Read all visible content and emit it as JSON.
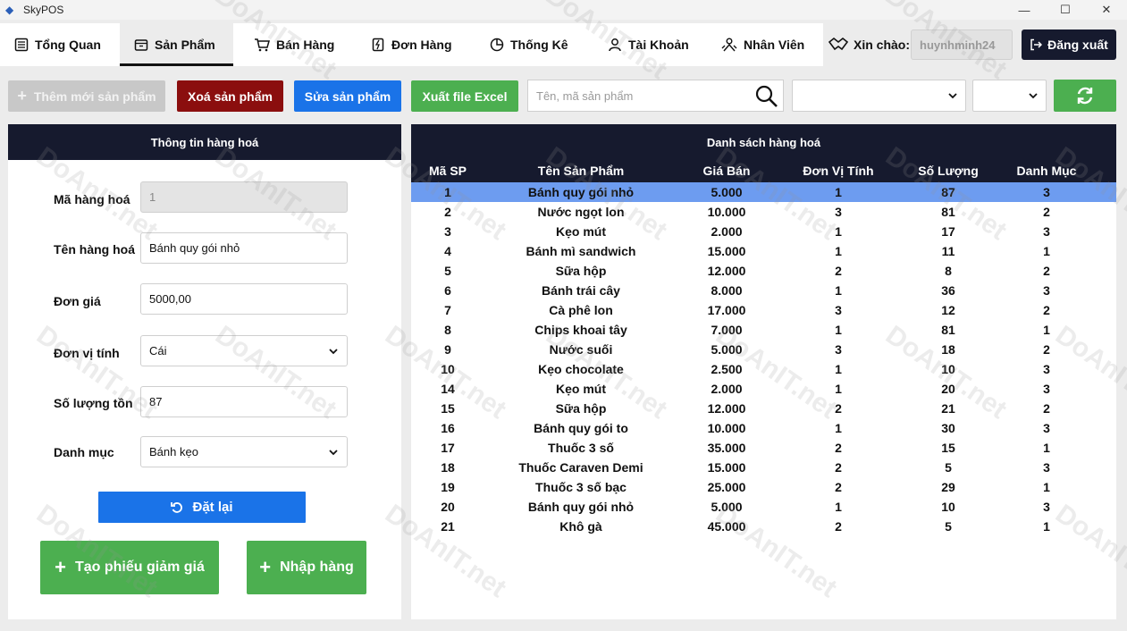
{
  "window": {
    "title": "SkyPOS",
    "minimize": "—",
    "maximize": "☐",
    "close": "✕"
  },
  "nav": {
    "tabs": [
      {
        "label": "Tổng Quan"
      },
      {
        "label": "Sản Phẩm"
      },
      {
        "label": "Bán Hàng"
      },
      {
        "label": "Đơn Hàng"
      },
      {
        "label": "Thống Kê"
      },
      {
        "label": "Tài Khoản"
      },
      {
        "label": "Nhân Viên"
      }
    ],
    "greeting": "Xin chào:",
    "username": "huynhminh24",
    "logout": "Đăng xuất"
  },
  "toolbar": {
    "add": "Thêm mới sản phẩm",
    "delete": "Xoá sản phẩm",
    "edit": "Sửa sản phẩm",
    "export": "Xuất file Excel",
    "search_placeholder": "Tên, mã sản phẩm",
    "filter1": "",
    "filter2": ""
  },
  "form": {
    "title": "Thông tin hàng hoá",
    "code_label": "Mã hàng hoá",
    "code_value": "1",
    "name_label": "Tên hàng hoá",
    "name_value": "Bánh quy gói nhỏ",
    "price_label": "Đơn giá",
    "price_value": "5000,00",
    "unit_label": "Đơn vị tính",
    "unit_value": "Cái",
    "stock_label": "Số lượng tồn",
    "stock_value": "87",
    "category_label": "Danh mục",
    "category_value": "Bánh kẹo",
    "reset": "Đặt lại",
    "discount": "Tạo phiếu giảm giá",
    "import": "Nhập hàng"
  },
  "list": {
    "title": "Danh sách hàng hoá",
    "columns": [
      "Mã SP",
      "Tên Sản Phẩm",
      "Giá Bán",
      "Đơn Vị Tính",
      "Số Lượng",
      "Danh Mục"
    ],
    "rows": [
      [
        "1",
        "Bánh quy gói nhỏ",
        "5.000",
        "1",
        "87",
        "3"
      ],
      [
        "2",
        "Nước ngọt lon",
        "10.000",
        "3",
        "81",
        "2"
      ],
      [
        "3",
        "Kẹo mút",
        "2.000",
        "1",
        "17",
        "3"
      ],
      [
        "4",
        "Bánh mì sandwich",
        "15.000",
        "1",
        "11",
        "1"
      ],
      [
        "5",
        "Sữa hộp",
        "12.000",
        "2",
        "8",
        "2"
      ],
      [
        "6",
        "Bánh trái cây",
        "8.000",
        "1",
        "36",
        "3"
      ],
      [
        "7",
        "Cà phê lon",
        "17.000",
        "3",
        "12",
        "2"
      ],
      [
        "8",
        "Chips khoai tây",
        "7.000",
        "1",
        "81",
        "1"
      ],
      [
        "9",
        "Nước suối",
        "5.000",
        "3",
        "18",
        "2"
      ],
      [
        "10",
        "Kẹo chocolate",
        "2.500",
        "1",
        "10",
        "3"
      ],
      [
        "14",
        "Kẹo mút",
        "2.000",
        "1",
        "20",
        "3"
      ],
      [
        "15",
        "Sữa hộp",
        "12.000",
        "2",
        "21",
        "2"
      ],
      [
        "16",
        "Bánh quy gói to",
        "10.000",
        "1",
        "30",
        "3"
      ],
      [
        "17",
        "Thuốc 3 số",
        "35.000",
        "2",
        "15",
        "1"
      ],
      [
        "18",
        "Thuốc Caraven Demi",
        "15.000",
        "2",
        "5",
        "3"
      ],
      [
        "19",
        "Thuốc 3 số bạc",
        "25.000",
        "2",
        "29",
        "1"
      ],
      [
        "20",
        "Bánh quy gói nhỏ",
        "5.000",
        "1",
        "10",
        "3"
      ],
      [
        "21",
        "Khô gà",
        "45.000",
        "2",
        "5",
        "1"
      ]
    ],
    "selected_index": 0
  },
  "watermark": "DoAnIT.net"
}
